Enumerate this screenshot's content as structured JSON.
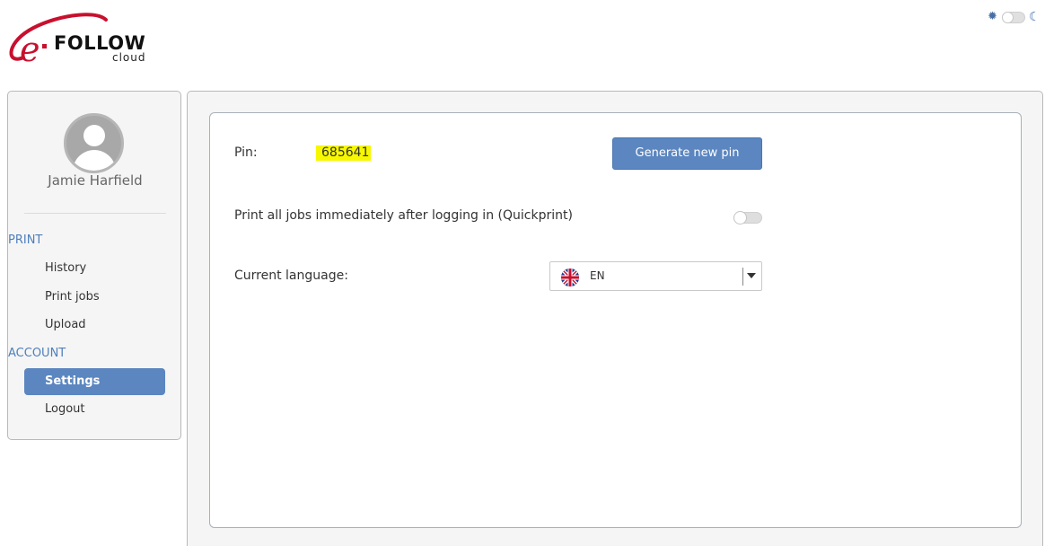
{
  "brand": {
    "name": "FOLLOW",
    "prefix": "e",
    "sub": "cloud",
    "accent_color": "#c8102e",
    "primary_color": "#5b86c0"
  },
  "theme": {
    "sun_icon": "sun-icon",
    "moon_icon": "moon-icon",
    "dark_mode": false
  },
  "sidebar": {
    "user_name": "Jamie Harfield",
    "sections": [
      {
        "label": "PRINT",
        "items": [
          {
            "label": "History",
            "active": false
          },
          {
            "label": "Print jobs",
            "active": false
          },
          {
            "label": "Upload",
            "active": false
          }
        ]
      },
      {
        "label": "ACCOUNT",
        "items": [
          {
            "label": "Settings",
            "active": true
          },
          {
            "label": "Logout",
            "active": false
          }
        ]
      }
    ]
  },
  "settings": {
    "pin_label": "Pin:",
    "pin_value": "685641",
    "generate_button": "Generate new pin",
    "quickprint_label": "Print all jobs immediately after logging in (Quickprint)",
    "quickprint_enabled": false,
    "language_label": "Current language:",
    "language_value": "EN",
    "language_flag": "uk-flag-icon"
  }
}
